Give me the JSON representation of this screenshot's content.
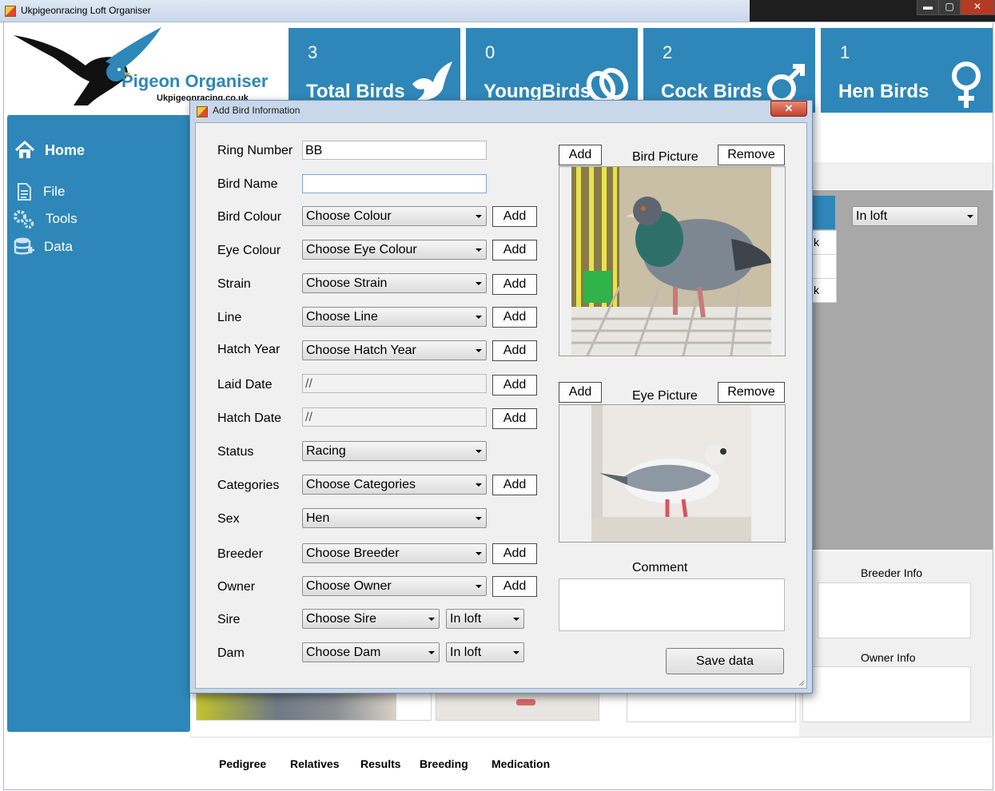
{
  "window": {
    "title": "Ukpigeonracing Loft Organiser",
    "minimize": "▬",
    "maximize": "▢",
    "close": "✕"
  },
  "logo": {
    "title": "Pigeon Organiser",
    "subtitle": "Ukpigeonracing.co.uk"
  },
  "tiles": [
    {
      "count": "3",
      "label": "Total Birds",
      "icon": "dove-icon"
    },
    {
      "count": "0",
      "label": "YoungBirds",
      "icon": "rings-icon"
    },
    {
      "count": "2",
      "label": "Cock Birds",
      "icon": "male-icon"
    },
    {
      "count": "1",
      "label": "Hen Birds",
      "icon": "female-icon"
    }
  ],
  "sidebar": {
    "items": [
      {
        "label": "Home",
        "icon": "home-icon"
      },
      {
        "label": "File",
        "icon": "document-icon"
      },
      {
        "label": "Tools",
        "icon": "gears-icon"
      },
      {
        "label": "Data",
        "icon": "database-icon"
      }
    ]
  },
  "background": {
    "status_value": "In loft",
    "row_fragments": [
      "k",
      "k"
    ],
    "breeder_info": "Breeder Info",
    "owner_info": "Owner Info",
    "tabs": [
      "Pedigree",
      "Relatives",
      "Results",
      "Breeding",
      "Medication"
    ]
  },
  "dialog": {
    "title": "Add Bird Information",
    "close": "✕",
    "fields": {
      "ring_number": {
        "label": "Ring Number",
        "value": "BB"
      },
      "bird_name": {
        "label": "Bird Name",
        "value": ""
      },
      "bird_colour": {
        "label": "Bird Colour",
        "value": "Choose Colour"
      },
      "eye_colour": {
        "label": "Eye Colour",
        "value": "Choose Eye Colour"
      },
      "strain": {
        "label": "Strain",
        "value": "Choose Strain"
      },
      "line": {
        "label": "Line",
        "value": "Choose Line"
      },
      "hatch_year": {
        "label": "Hatch Year",
        "value": "Choose Hatch Year"
      },
      "laid_date": {
        "label": "Laid Date",
        "value": "//"
      },
      "hatch_date": {
        "label": "Hatch Date",
        "value": "//"
      },
      "status": {
        "label": "Status",
        "value": "Racing"
      },
      "categories": {
        "label": "Categories",
        "value": "Choose Categories"
      },
      "sex": {
        "label": "Sex",
        "value": "Hen"
      },
      "breeder": {
        "label": "Breeder",
        "value": "Choose Breeder"
      },
      "owner": {
        "label": "Owner",
        "value": "Choose Owner"
      },
      "sire": {
        "label": "Sire",
        "value": "Choose Sire",
        "status": "In loft"
      },
      "dam": {
        "label": "Dam",
        "value": "Choose Dam",
        "status": "In loft"
      }
    },
    "add_label": "Add",
    "remove_label": "Remove",
    "bird_picture": "Bird Picture",
    "eye_picture": "Eye Picture",
    "comment_label": "Comment",
    "comment_value": "",
    "save_label": "Save data"
  },
  "colors": {
    "accent": "#2e87b8",
    "dialog_frame": "#c8d8ea",
    "client_bg": "#f0f0f0"
  }
}
